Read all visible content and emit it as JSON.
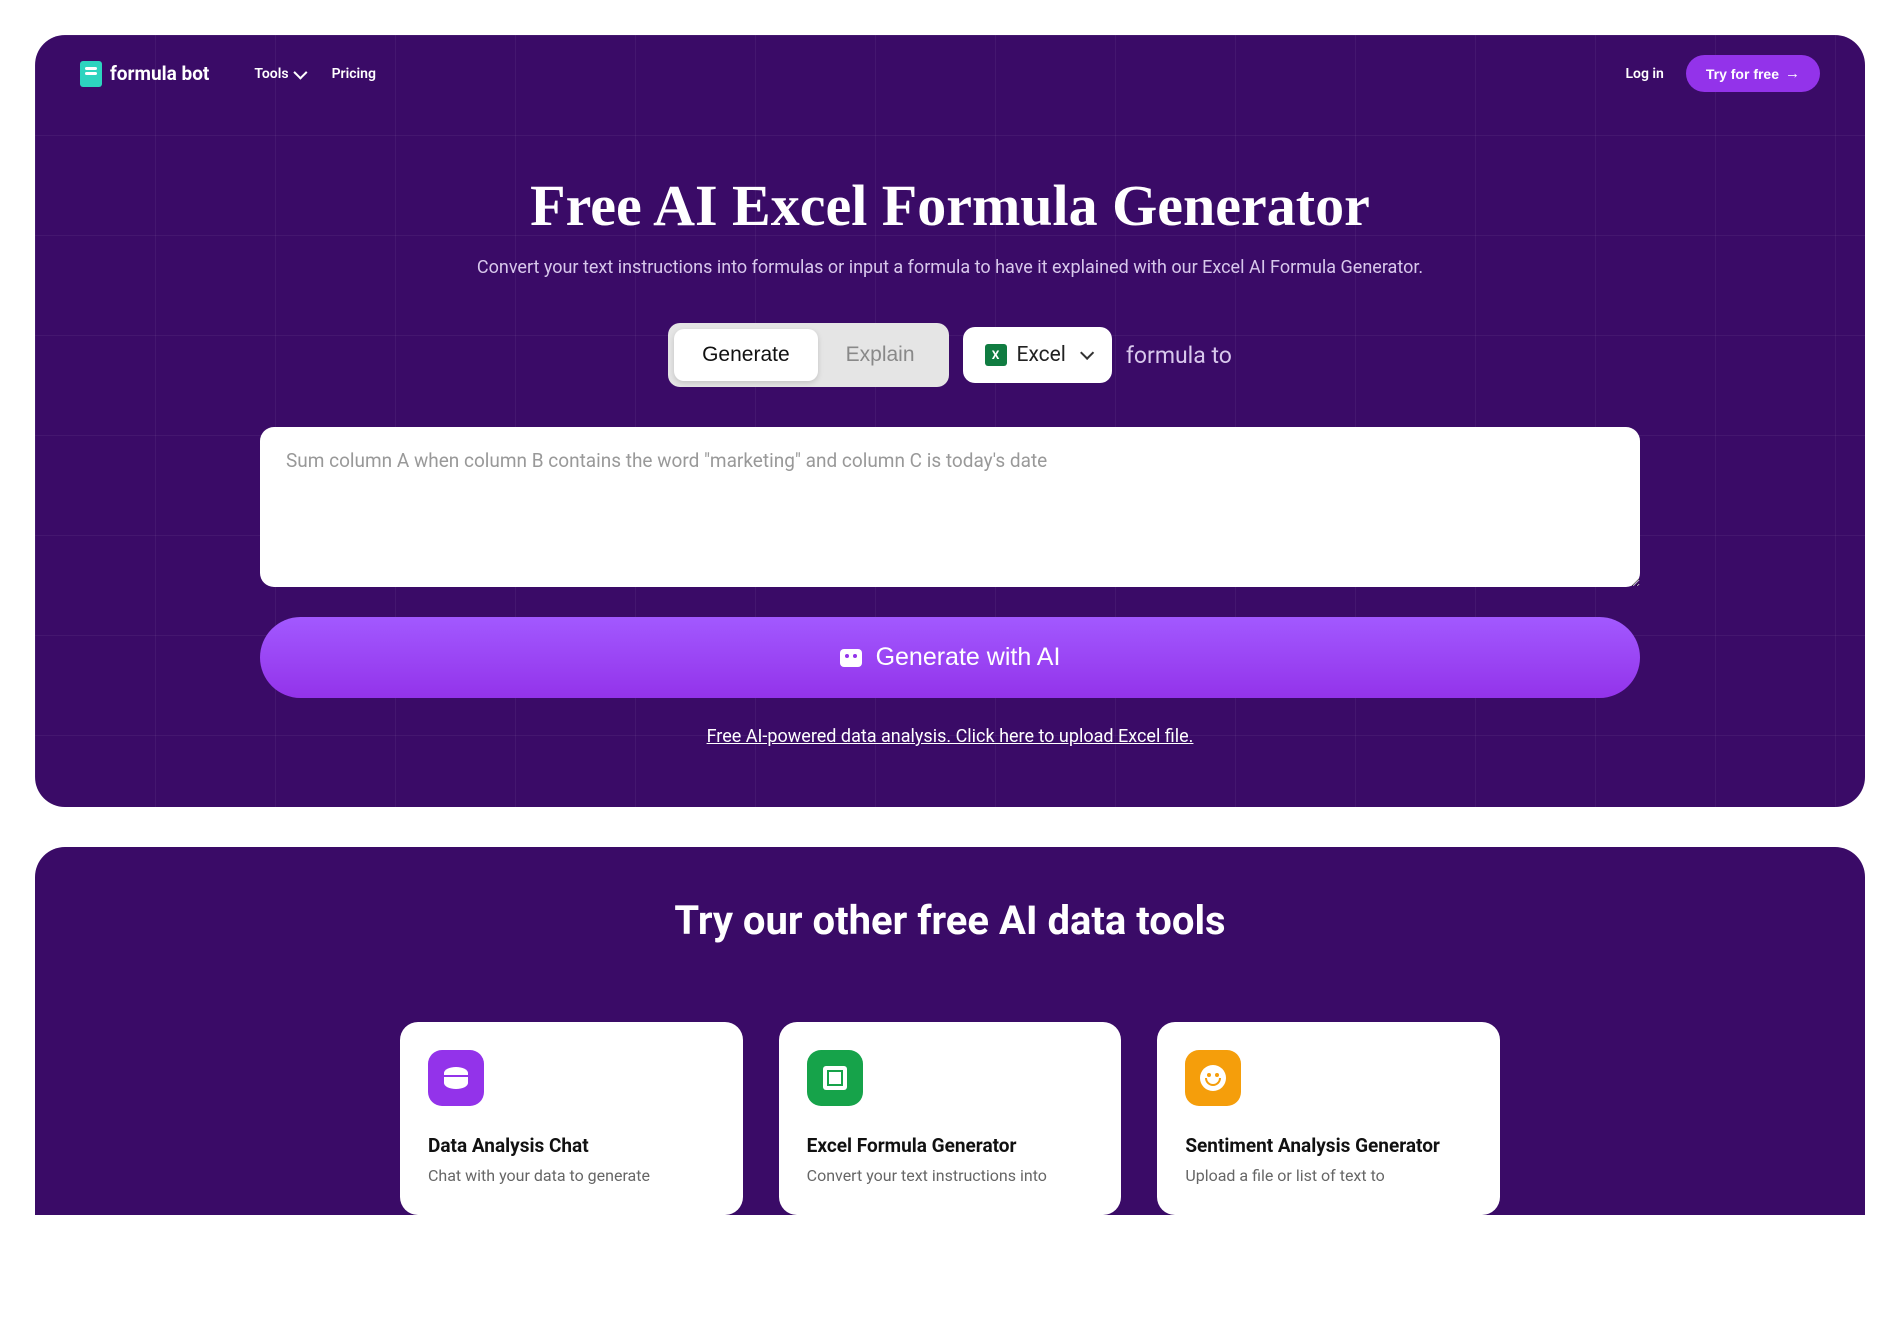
{
  "nav": {
    "brand": "formula bot",
    "links": {
      "tools": "Tools",
      "pricing": "Pricing"
    },
    "login": "Log in",
    "try_free": "Try for free"
  },
  "hero": {
    "title": "Free AI Excel Formula Generator",
    "subtitle": "Convert your text instructions into formulas or input a formula to have it explained with our Excel AI Formula Generator.",
    "toggle": {
      "generate": "Generate",
      "explain": "Explain"
    },
    "dropdown_value": "Excel",
    "formula_label": "formula to",
    "textarea_placeholder": "Sum column A when column B contains the word \"marketing\" and column C is today's date",
    "generate_btn": "Generate with AI",
    "upload_link": "Free AI-powered data analysis. Click here to upload Excel file."
  },
  "tools_section": {
    "title": "Try our other free AI data tools",
    "cards": [
      {
        "title": "Data Analysis Chat",
        "desc": "Chat with your data to generate"
      },
      {
        "title": "Excel Formula Generator",
        "desc": "Convert your text instructions into"
      },
      {
        "title": "Sentiment Analysis Generator",
        "desc": "Upload a file or list of text to"
      }
    ]
  }
}
